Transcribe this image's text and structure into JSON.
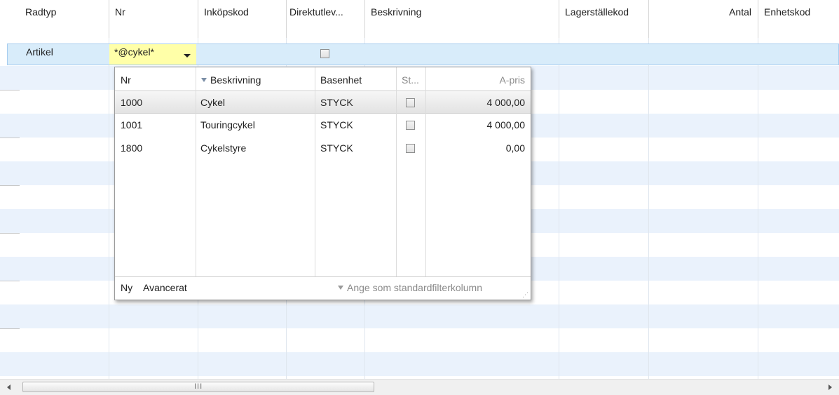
{
  "columns": [
    "Radtyp",
    "Nr",
    "Inköpskod",
    "Direktutlev...",
    "Beskrivning",
    "Lagerställekod",
    "Antal",
    "Enhetskod"
  ],
  "current_row": {
    "radtyp": "Artikel",
    "nr_input": "*@cykel*",
    "direktutlev_checked": false
  },
  "lookup": {
    "columns": [
      "Nr",
      "Beskrivning",
      "Basenhet",
      "St...",
      "A-pris"
    ],
    "rows": [
      {
        "nr": "1000",
        "beskrivning": "Cykel",
        "basenhet": "STYCK",
        "st": false,
        "apris": "4 000,00"
      },
      {
        "nr": "1001",
        "beskrivning": "Touringcykel",
        "basenhet": "STYCK",
        "st": false,
        "apris": "4 000,00"
      },
      {
        "nr": "1800",
        "beskrivning": "Cykelstyre",
        "basenhet": "STYCK",
        "st": false,
        "apris": "0,00"
      }
    ],
    "footer": {
      "ny": "Ny",
      "avancerat": "Avancerat",
      "set_default_filter": "Ange som standardfilterkolumn"
    }
  },
  "scrollbar": {
    "thumb_grip": "III"
  },
  "colors": {
    "stripe": "#eaf2fc",
    "selected_row": "#d8ecfa",
    "input_highlight": "#ffffa8"
  }
}
